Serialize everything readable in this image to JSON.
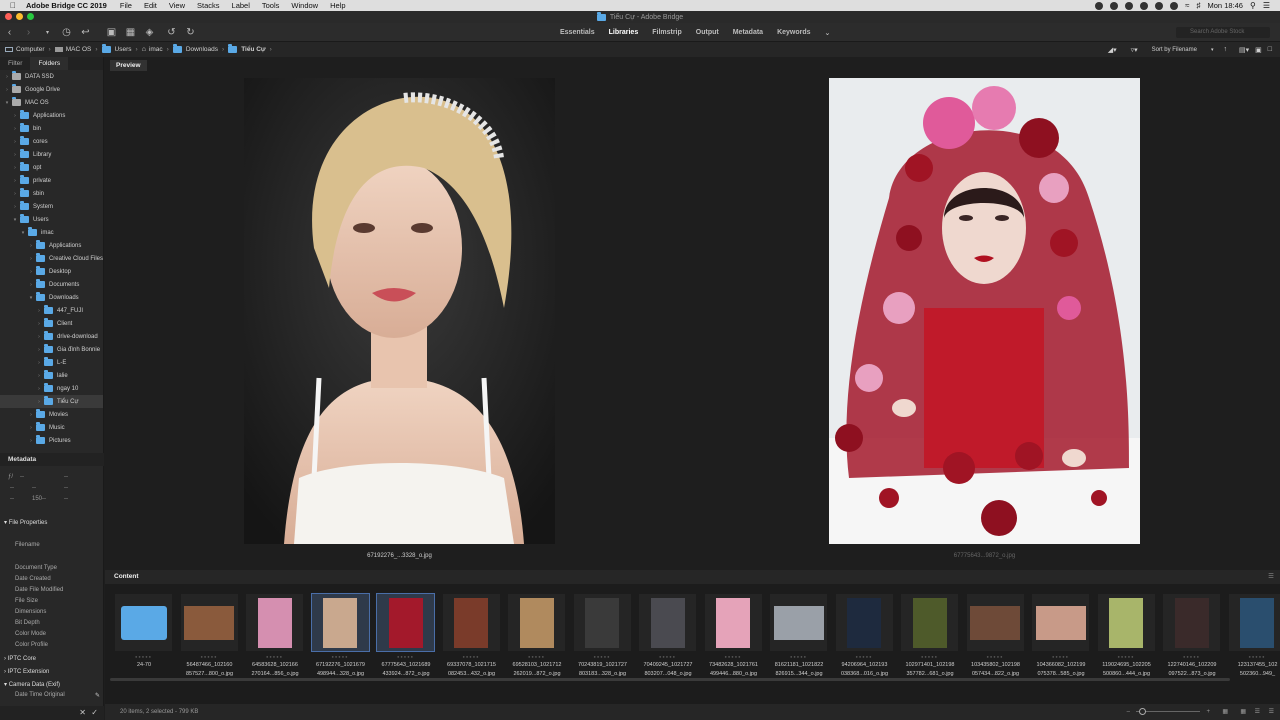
{
  "menubar": {
    "app_name": "Adobe Bridge CC 2019",
    "items": [
      "File",
      "Edit",
      "View",
      "Stacks",
      "Label",
      "Tools",
      "Window",
      "Help"
    ],
    "clock": "Mon 18:46"
  },
  "window": {
    "title": "Tiểu Cự - Adobe Bridge"
  },
  "toolbar": {
    "workspaces": [
      {
        "label": "Essentials",
        "active": false
      },
      {
        "label": "Libraries",
        "active": true
      },
      {
        "label": "Filmstrip",
        "active": false
      },
      {
        "label": "Output",
        "active": false
      },
      {
        "label": "Metadata",
        "active": false
      },
      {
        "label": "Keywords",
        "active": false
      }
    ],
    "search_placeholder": "Search Adobe Stock"
  },
  "path": {
    "crumbs": [
      "Computer",
      "MAC OS",
      "Users",
      "imac",
      "Downloads",
      "Tiểu Cự"
    ],
    "sort_label": "Sort by Filename"
  },
  "left_panel": {
    "tabs": [
      "Filter",
      "Folders"
    ],
    "tree": [
      {
        "label": "DATA SSD",
        "level": 0
      },
      {
        "label": "Google Drive",
        "level": 0
      },
      {
        "label": "MAC OS",
        "level": 0
      },
      {
        "label": "Applications",
        "level": 1
      },
      {
        "label": "bin",
        "level": 1
      },
      {
        "label": "cores",
        "level": 1
      },
      {
        "label": "Library",
        "level": 1
      },
      {
        "label": "opt",
        "level": 1
      },
      {
        "label": "private",
        "level": 1
      },
      {
        "label": "sbin",
        "level": 1
      },
      {
        "label": "System",
        "level": 1
      },
      {
        "label": "Users",
        "level": 1
      },
      {
        "label": "imac",
        "level": 2
      },
      {
        "label": "Applications",
        "level": 3
      },
      {
        "label": "Creative Cloud Files",
        "level": 3
      },
      {
        "label": "Desktop",
        "level": 3
      },
      {
        "label": "Documents",
        "level": 3
      },
      {
        "label": "Downloads",
        "level": 3
      },
      {
        "label": "447_FUJI",
        "level": 4
      },
      {
        "label": "Client",
        "level": 4
      },
      {
        "label": "drive-download",
        "level": 4
      },
      {
        "label": "Gia đình Bonnie",
        "level": 4
      },
      {
        "label": "L-E",
        "level": 4
      },
      {
        "label": "lalie",
        "level": 4
      },
      {
        "label": "ngay 10",
        "level": 4
      },
      {
        "label": "Tiểu Cự",
        "level": 4,
        "selected": true
      },
      {
        "label": "Movies",
        "level": 3
      },
      {
        "label": "Music",
        "level": 3
      },
      {
        "label": "Pictures",
        "level": 3
      }
    ],
    "metadata_title": "Metadata",
    "meta_values": [
      "--",
      "--",
      "--",
      "--",
      "--",
      "150--",
      "--",
      "--"
    ],
    "sections": [
      "File Properties",
      "IPTC Core",
      "IPTC Extension",
      "Camera Data (Exif)"
    ],
    "file_props": [
      "Filename",
      "Document Type",
      "Date Created",
      "Date File Modified",
      "File Size",
      "Dimensions",
      "Bit Depth",
      "Color Mode",
      "Color Profile"
    ],
    "camera_prop": "Date Time Original"
  },
  "preview": {
    "tab_label": "Preview",
    "left_caption": "67192276_...3328_o.jpg",
    "right_caption": "67775643...9872_o.jpg"
  },
  "content": {
    "title": "Content",
    "items": [
      {
        "line1": "24-70",
        "line2": "",
        "type": "folder"
      },
      {
        "line1": "56487466_102160",
        "line2": "857527...800_o.jpg",
        "color": "#8a5a3c"
      },
      {
        "line1": "64583628_102166",
        "line2": "270164...856_o.jpg",
        "color": "#d58fb0"
      },
      {
        "line1": "67192276_1021679",
        "line2": "498944...328_o.jpg",
        "color": "#c9a88e",
        "selected": true
      },
      {
        "line1": "67775643_1021689",
        "line2": "433924...872_o.jpg",
        "color": "#a3192b",
        "selected": true
      },
      {
        "line1": "69337078_1021715",
        "line2": "082453...432_o.jpg",
        "color": "#7a3b2a"
      },
      {
        "line1": "69528103_1021712",
        "line2": "262019...872_o.jpg",
        "color": "#b08a5e"
      },
      {
        "line1": "70243819_1021727",
        "line2": "803183...328_o.jpg",
        "color": "#3a3a3a"
      },
      {
        "line1": "70409245_1021727",
        "line2": "803207...048_o.jpg",
        "color": "#4a4a50"
      },
      {
        "line1": "73482628_1021761",
        "line2": "499446...880_o.jpg",
        "color": "#e5a3b9"
      },
      {
        "line1": "81621181_1021822",
        "line2": "826915...344_o.jpg",
        "color": "#9aa0a8"
      },
      {
        "line1": "94206964_102193",
        "line2": "038368...016_o.jpg",
        "color": "#1e2a3e"
      },
      {
        "line1": "102971401_102198",
        "line2": "357782...681_o.jpg",
        "color": "#4e5a2a"
      },
      {
        "line1": "103435802_102198",
        "line2": "057434...822_o.jpg",
        "color": "#6e4a38"
      },
      {
        "line1": "104366082_102199",
        "line2": "075378...585_o.jpg",
        "color": "#c89a88"
      },
      {
        "line1": "119024695_102205",
        "line2": "500860...444_o.jpg",
        "color": "#a8b56a"
      },
      {
        "line1": "122740146_102209",
        "line2": "097522...873_o.jpg",
        "color": "#3a2a2a"
      },
      {
        "line1": "123137455_102",
        "line2": "502360...949_",
        "color": "#2a4e6e"
      }
    ],
    "status": "20 items, 2 selected - 799 KB"
  }
}
